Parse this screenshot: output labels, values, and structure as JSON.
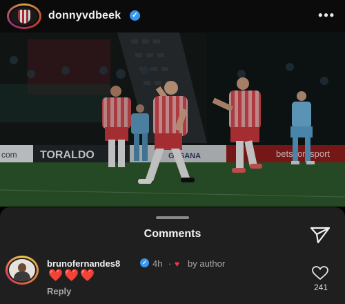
{
  "header": {
    "username": "donnyvdbeek",
    "verified": true,
    "more_icon": "more-horizontal-icon"
  },
  "photo": {
    "boards": {
      "left": "com",
      "middle": "TORALDO",
      "right_small": "GESANA",
      "right": "betsson sport"
    }
  },
  "comments": {
    "title": "Comments",
    "share_icon": "send-icon",
    "items": [
      {
        "username": "brunofernandes8",
        "verified": true,
        "time": "4h",
        "separator": "·",
        "liked_icon": "♥",
        "by_author": "by author",
        "text": "❤️❤️❤️",
        "reply": "Reply",
        "likes": "241"
      }
    ]
  },
  "colors": {
    "verified_blue": "#3897f0",
    "heart_red": "#ed3b4b",
    "sheet_bg": "#1f1f1f"
  }
}
